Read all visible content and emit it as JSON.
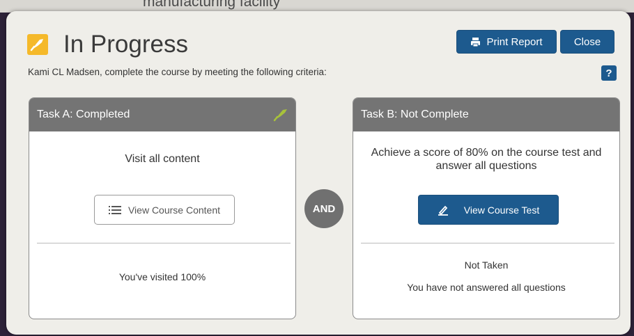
{
  "background": {
    "cut_off_text": "manufacturing facility"
  },
  "header": {
    "title": "In Progress",
    "status_icon": "yellow-progress-icon",
    "print_label": "Print Report",
    "close_label": "Close",
    "help_label": "?"
  },
  "subtitle": "Kami CL Madsen, complete the course by meeting the following criteria:",
  "task_a": {
    "header": "Task A: Completed",
    "description": "Visit all content",
    "button_label": "View Course Content",
    "status": "You've visited 100%"
  },
  "connector": "AND",
  "task_b": {
    "header": "Task B: Not Complete",
    "description": "Achieve a score of 80% on the course test and answer all questions",
    "button_label": "View Course Test",
    "status_line1": "Not Taken",
    "status_line2": "You have not answered all questions"
  },
  "colors": {
    "primary": "#1d5a8e",
    "header_gray": "#747474",
    "accent_yellow": "#f5b92a",
    "check_green": "#a8c23a"
  }
}
